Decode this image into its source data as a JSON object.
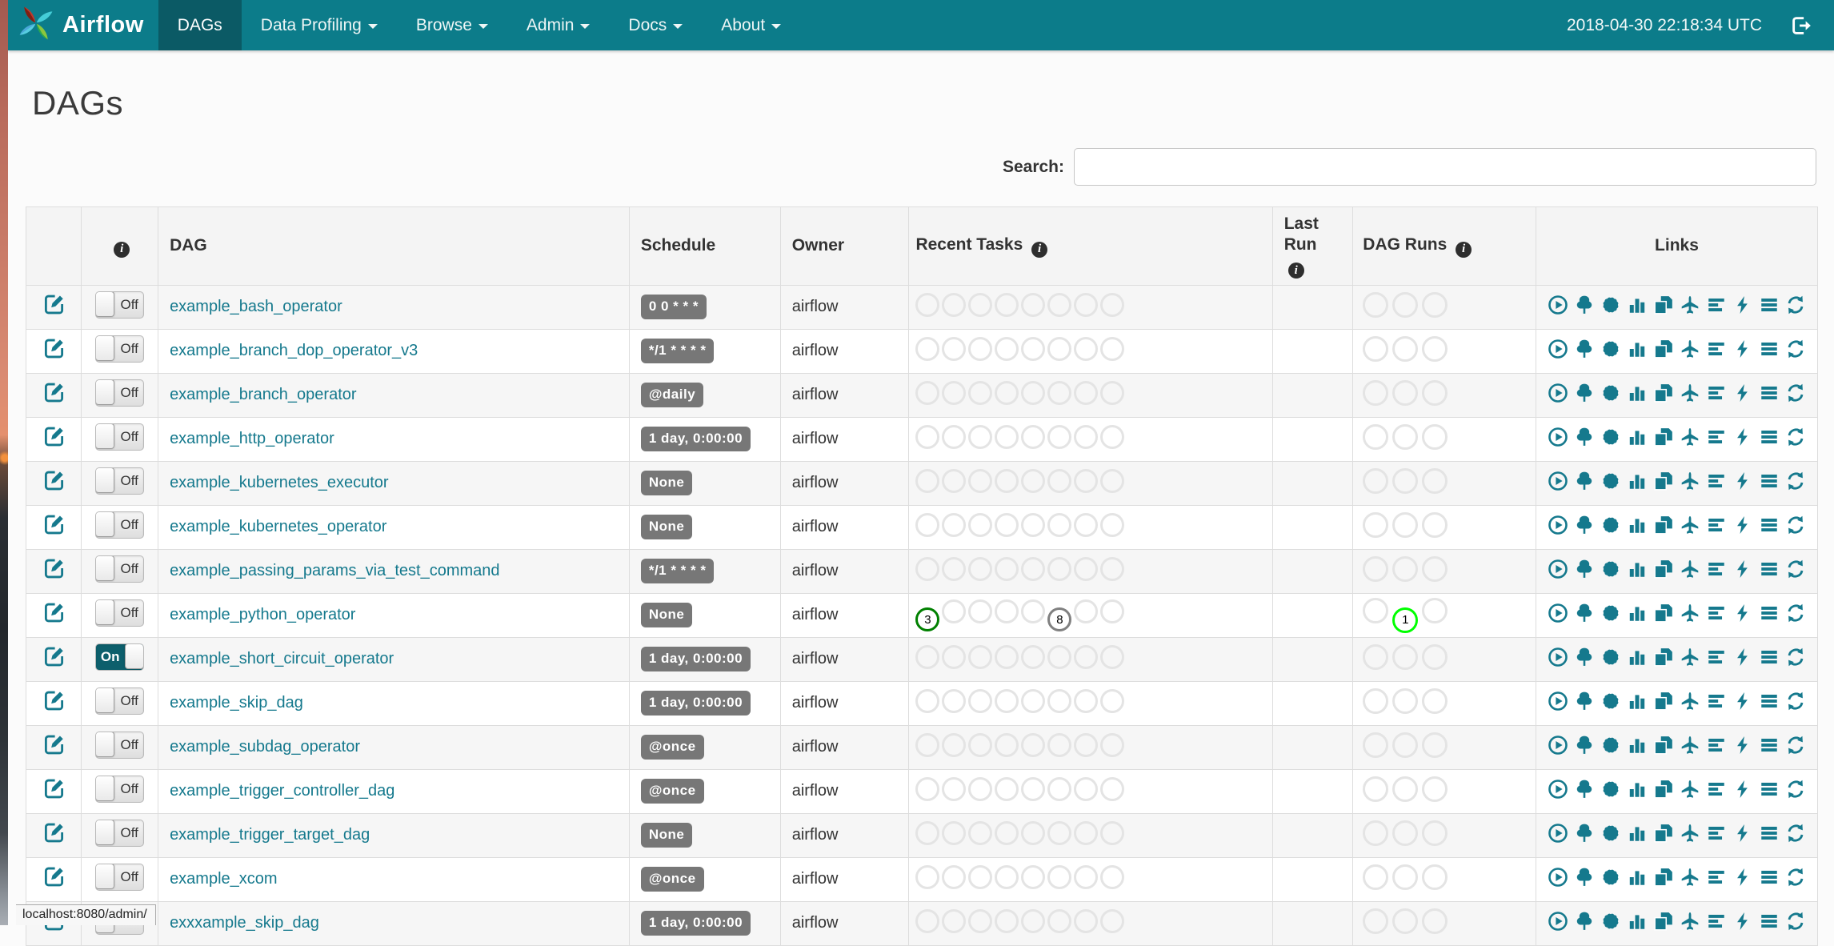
{
  "navbar": {
    "brand": "Airflow",
    "items": [
      {
        "label": "DAGs",
        "active": true,
        "dropdown": false
      },
      {
        "label": "Data Profiling",
        "active": false,
        "dropdown": true
      },
      {
        "label": "Browse",
        "active": false,
        "dropdown": true
      },
      {
        "label": "Admin",
        "active": false,
        "dropdown": true
      },
      {
        "label": "Docs",
        "active": false,
        "dropdown": true
      },
      {
        "label": "About",
        "active": false,
        "dropdown": true
      }
    ],
    "clock": "2018-04-30 22:18:34 UTC",
    "logout_icon": "sign-out-icon"
  },
  "page": {
    "title": "DAGs",
    "search_label": "Search:",
    "search_value": "",
    "status_bar": "localhost:8080/admin/"
  },
  "table": {
    "columns": [
      {
        "label": "",
        "info_icon": false
      },
      {
        "label": "",
        "info_icon": true
      },
      {
        "label": "DAG",
        "info_icon": false
      },
      {
        "label": "Schedule",
        "info_icon": false
      },
      {
        "label": "Owner",
        "info_icon": false
      },
      {
        "label": "Recent Tasks",
        "info_icon": true
      },
      {
        "label": "Last Run",
        "info_icon": true,
        "wrap": true
      },
      {
        "label": "DAG Runs",
        "info_icon": true
      },
      {
        "label": "Links",
        "info_icon": false,
        "center": true
      }
    ],
    "recent_task_slots": 8,
    "dag_run_slots": 3,
    "links_icons": [
      "trigger-dag-icon",
      "tree-view-icon",
      "graph-view-icon",
      "task-duration-icon",
      "task-tries-icon",
      "landing-times-icon",
      "gantt-icon",
      "code-view-icon",
      "dag-details-icon",
      "refresh-icon"
    ],
    "rows": [
      {
        "dag": "example_bash_operator",
        "toggle": "Off",
        "schedule": "0 0 * * *",
        "owner": "airflow",
        "last_run": "",
        "recent_tasks": [],
        "dag_runs": []
      },
      {
        "dag": "example_branch_dop_operator_v3",
        "toggle": "Off",
        "schedule": "*/1 * * * *",
        "owner": "airflow",
        "last_run": "",
        "recent_tasks": [],
        "dag_runs": []
      },
      {
        "dag": "example_branch_operator",
        "toggle": "Off",
        "schedule": "@daily",
        "owner": "airflow",
        "last_run": "",
        "recent_tasks": [],
        "dag_runs": []
      },
      {
        "dag": "example_http_operator",
        "toggle": "Off",
        "schedule": "1 day, 0:00:00",
        "owner": "airflow",
        "last_run": "",
        "recent_tasks": [],
        "dag_runs": []
      },
      {
        "dag": "example_kubernetes_executor",
        "toggle": "Off",
        "schedule": "None",
        "owner": "airflow",
        "last_run": "",
        "recent_tasks": [],
        "dag_runs": []
      },
      {
        "dag": "example_kubernetes_operator",
        "toggle": "Off",
        "schedule": "None",
        "owner": "airflow",
        "last_run": "",
        "recent_tasks": [],
        "dag_runs": []
      },
      {
        "dag": "example_passing_params_via_test_command",
        "toggle": "Off",
        "schedule": "*/1 * * * *",
        "owner": "airflow",
        "last_run": "",
        "recent_tasks": [],
        "dag_runs": []
      },
      {
        "dag": "example_python_operator",
        "toggle": "Off",
        "schedule": "None",
        "owner": "airflow",
        "last_run": "",
        "recent_tasks": [
          {
            "slot": 0,
            "count": "3",
            "color": "#008000"
          },
          {
            "slot": 5,
            "count": "8",
            "color": "#808080"
          }
        ],
        "dag_runs": [
          {
            "slot": 1,
            "count": "1",
            "color": "#00ff00"
          }
        ]
      },
      {
        "dag": "example_short_circuit_operator",
        "toggle": "On",
        "schedule": "1 day, 0:00:00",
        "owner": "airflow",
        "last_run": "",
        "recent_tasks": [],
        "dag_runs": []
      },
      {
        "dag": "example_skip_dag",
        "toggle": "Off",
        "schedule": "1 day, 0:00:00",
        "owner": "airflow",
        "last_run": "",
        "recent_tasks": [],
        "dag_runs": []
      },
      {
        "dag": "example_subdag_operator",
        "toggle": "Off",
        "schedule": "@once",
        "owner": "airflow",
        "last_run": "",
        "recent_tasks": [],
        "dag_runs": []
      },
      {
        "dag": "example_trigger_controller_dag",
        "toggle": "Off",
        "schedule": "@once",
        "owner": "airflow",
        "last_run": "",
        "recent_tasks": [],
        "dag_runs": []
      },
      {
        "dag": "example_trigger_target_dag",
        "toggle": "Off",
        "schedule": "None",
        "owner": "airflow",
        "last_run": "",
        "recent_tasks": [],
        "dag_runs": []
      },
      {
        "dag": "example_xcom",
        "toggle": "Off",
        "schedule": "@once",
        "owner": "airflow",
        "last_run": "",
        "recent_tasks": [],
        "dag_runs": []
      },
      {
        "dag": "exxxample_skip_dag",
        "toggle": "Off",
        "schedule": "1 day, 0:00:00",
        "owner": "airflow",
        "last_run": "",
        "recent_tasks": [],
        "dag_runs": []
      }
    ]
  },
  "colors": {
    "navbar": "#0c7c8a",
    "navbar_active": "#0b5a65",
    "link_teal": "#15798d",
    "badge_gray": "#777777",
    "toggle_on": "#0d5f6c",
    "circle_empty": "#e4e4e4",
    "circle_success": "#008000",
    "circle_running": "#00ff00",
    "circle_gray": "#808080"
  }
}
